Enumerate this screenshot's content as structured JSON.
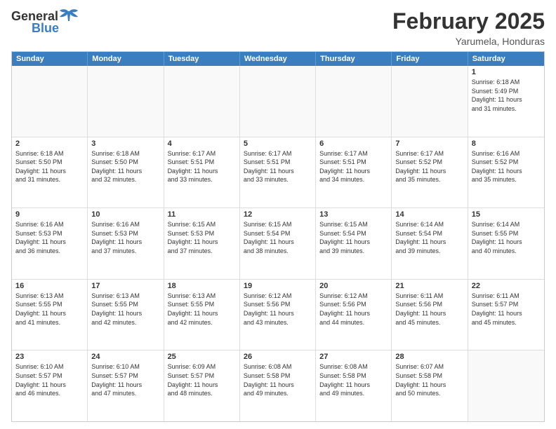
{
  "header": {
    "logo_general": "General",
    "logo_blue": "Blue",
    "month_year": "February 2025",
    "location": "Yarumela, Honduras"
  },
  "day_headers": [
    "Sunday",
    "Monday",
    "Tuesday",
    "Wednesday",
    "Thursday",
    "Friday",
    "Saturday"
  ],
  "weeks": [
    {
      "days": [
        {
          "number": "",
          "info": "",
          "empty": true
        },
        {
          "number": "",
          "info": "",
          "empty": true
        },
        {
          "number": "",
          "info": "",
          "empty": true
        },
        {
          "number": "",
          "info": "",
          "empty": true
        },
        {
          "number": "",
          "info": "",
          "empty": true
        },
        {
          "number": "",
          "info": "",
          "empty": true
        },
        {
          "number": "1",
          "info": "Sunrise: 6:18 AM\nSunset: 5:49 PM\nDaylight: 11 hours\nand 31 minutes.",
          "empty": false
        }
      ]
    },
    {
      "days": [
        {
          "number": "2",
          "info": "Sunrise: 6:18 AM\nSunset: 5:50 PM\nDaylight: 11 hours\nand 31 minutes.",
          "empty": false
        },
        {
          "number": "3",
          "info": "Sunrise: 6:18 AM\nSunset: 5:50 PM\nDaylight: 11 hours\nand 32 minutes.",
          "empty": false
        },
        {
          "number": "4",
          "info": "Sunrise: 6:17 AM\nSunset: 5:51 PM\nDaylight: 11 hours\nand 33 minutes.",
          "empty": false
        },
        {
          "number": "5",
          "info": "Sunrise: 6:17 AM\nSunset: 5:51 PM\nDaylight: 11 hours\nand 33 minutes.",
          "empty": false
        },
        {
          "number": "6",
          "info": "Sunrise: 6:17 AM\nSunset: 5:51 PM\nDaylight: 11 hours\nand 34 minutes.",
          "empty": false
        },
        {
          "number": "7",
          "info": "Sunrise: 6:17 AM\nSunset: 5:52 PM\nDaylight: 11 hours\nand 35 minutes.",
          "empty": false
        },
        {
          "number": "8",
          "info": "Sunrise: 6:16 AM\nSunset: 5:52 PM\nDaylight: 11 hours\nand 35 minutes.",
          "empty": false
        }
      ]
    },
    {
      "days": [
        {
          "number": "9",
          "info": "Sunrise: 6:16 AM\nSunset: 5:53 PM\nDaylight: 11 hours\nand 36 minutes.",
          "empty": false
        },
        {
          "number": "10",
          "info": "Sunrise: 6:16 AM\nSunset: 5:53 PM\nDaylight: 11 hours\nand 37 minutes.",
          "empty": false
        },
        {
          "number": "11",
          "info": "Sunrise: 6:15 AM\nSunset: 5:53 PM\nDaylight: 11 hours\nand 37 minutes.",
          "empty": false
        },
        {
          "number": "12",
          "info": "Sunrise: 6:15 AM\nSunset: 5:54 PM\nDaylight: 11 hours\nand 38 minutes.",
          "empty": false
        },
        {
          "number": "13",
          "info": "Sunrise: 6:15 AM\nSunset: 5:54 PM\nDaylight: 11 hours\nand 39 minutes.",
          "empty": false
        },
        {
          "number": "14",
          "info": "Sunrise: 6:14 AM\nSunset: 5:54 PM\nDaylight: 11 hours\nand 39 minutes.",
          "empty": false
        },
        {
          "number": "15",
          "info": "Sunrise: 6:14 AM\nSunset: 5:55 PM\nDaylight: 11 hours\nand 40 minutes.",
          "empty": false
        }
      ]
    },
    {
      "days": [
        {
          "number": "16",
          "info": "Sunrise: 6:13 AM\nSunset: 5:55 PM\nDaylight: 11 hours\nand 41 minutes.",
          "empty": false
        },
        {
          "number": "17",
          "info": "Sunrise: 6:13 AM\nSunset: 5:55 PM\nDaylight: 11 hours\nand 42 minutes.",
          "empty": false
        },
        {
          "number": "18",
          "info": "Sunrise: 6:13 AM\nSunset: 5:55 PM\nDaylight: 11 hours\nand 42 minutes.",
          "empty": false
        },
        {
          "number": "19",
          "info": "Sunrise: 6:12 AM\nSunset: 5:56 PM\nDaylight: 11 hours\nand 43 minutes.",
          "empty": false
        },
        {
          "number": "20",
          "info": "Sunrise: 6:12 AM\nSunset: 5:56 PM\nDaylight: 11 hours\nand 44 minutes.",
          "empty": false
        },
        {
          "number": "21",
          "info": "Sunrise: 6:11 AM\nSunset: 5:56 PM\nDaylight: 11 hours\nand 45 minutes.",
          "empty": false
        },
        {
          "number": "22",
          "info": "Sunrise: 6:11 AM\nSunset: 5:57 PM\nDaylight: 11 hours\nand 45 minutes.",
          "empty": false
        }
      ]
    },
    {
      "days": [
        {
          "number": "23",
          "info": "Sunrise: 6:10 AM\nSunset: 5:57 PM\nDaylight: 11 hours\nand 46 minutes.",
          "empty": false
        },
        {
          "number": "24",
          "info": "Sunrise: 6:10 AM\nSunset: 5:57 PM\nDaylight: 11 hours\nand 47 minutes.",
          "empty": false
        },
        {
          "number": "25",
          "info": "Sunrise: 6:09 AM\nSunset: 5:57 PM\nDaylight: 11 hours\nand 48 minutes.",
          "empty": false
        },
        {
          "number": "26",
          "info": "Sunrise: 6:08 AM\nSunset: 5:58 PM\nDaylight: 11 hours\nand 49 minutes.",
          "empty": false
        },
        {
          "number": "27",
          "info": "Sunrise: 6:08 AM\nSunset: 5:58 PM\nDaylight: 11 hours\nand 49 minutes.",
          "empty": false
        },
        {
          "number": "28",
          "info": "Sunrise: 6:07 AM\nSunset: 5:58 PM\nDaylight: 11 hours\nand 50 minutes.",
          "empty": false
        },
        {
          "number": "",
          "info": "",
          "empty": true
        }
      ]
    }
  ]
}
